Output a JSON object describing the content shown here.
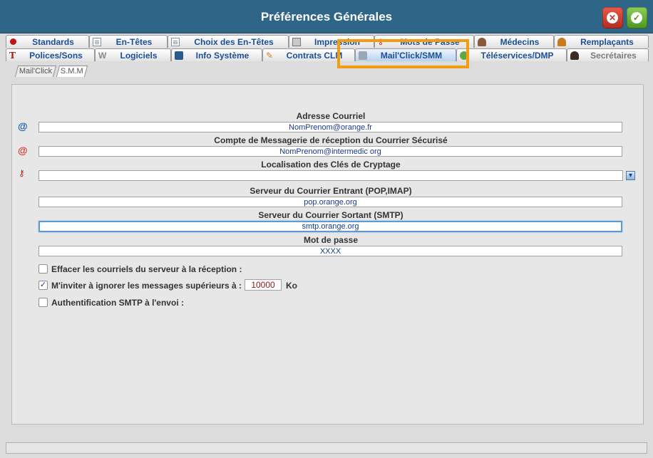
{
  "window": {
    "title": "Préférences Générales"
  },
  "tabs_row1": [
    "Standards",
    "En-Têtes",
    "Choix des En-Têtes",
    "Impression",
    "Mots de Passe",
    "Médecins",
    "Remplaçants"
  ],
  "tabs_row2": [
    "Polices/Sons",
    "Logiciels",
    "Info Système",
    "Contrats CLM",
    "Mail'Click/SMM",
    "Téléservices/DMP",
    "Secrétaires"
  ],
  "subtabs": [
    "Mail'Click",
    "S.M.M"
  ],
  "fields": {
    "email": {
      "label": "Adresse Courriel",
      "value": "NomPrenom@orange.fr"
    },
    "secure_account": {
      "label": "Compte de Messagerie de réception du Courrier Sécurisé",
      "value": "NomPrenom@intermedic org"
    },
    "crypto_keys": {
      "label": "Localisation des Clés de Cryptage",
      "value": ""
    },
    "incoming_server": {
      "label": "Serveur du Courrier Entrant (POP,IMAP)",
      "value": "pop.orange.org"
    },
    "outgoing_server": {
      "label": "Serveur du Courrier Sortant (SMTP)",
      "value": "smtp.orange.org"
    },
    "password": {
      "label": "Mot de passe",
      "value": "XXXX"
    }
  },
  "options": {
    "delete_on_server": {
      "label": "Effacer les courriels du serveur à la réception :",
      "checked": false
    },
    "ignore_large": {
      "label": "M'inviter à ignorer les messages supérieurs à :",
      "checked": true,
      "size_value": "10000",
      "unit": "Ko"
    },
    "smtp_auth": {
      "label": "Authentification SMTP à l'envoi :",
      "checked": false
    }
  },
  "colors": {
    "titlebar": "#2f6688",
    "highlight": "#f39c12",
    "tab_text": "#1a4f9a"
  },
  "icons": {
    "cancel": "cancel-icon",
    "ok": "ok-icon",
    "email_field": "at-sign-icon",
    "secure_field": "at-sign-icon",
    "crypto_field": "key-icon",
    "browse": "browse-icon"
  }
}
